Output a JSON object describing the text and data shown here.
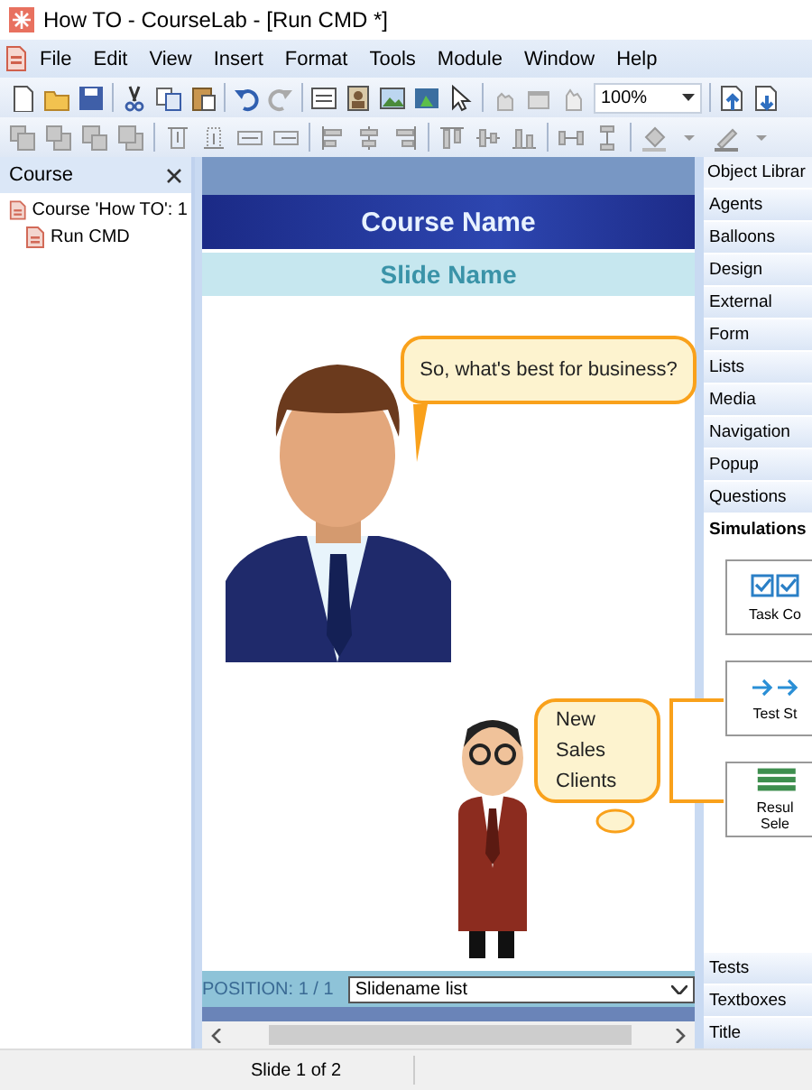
{
  "window": {
    "title": "How TO - CourseLab - [Run CMD *]"
  },
  "menu": [
    {
      "label": "File"
    },
    {
      "label": "Edit"
    },
    {
      "label": "View"
    },
    {
      "label": "Insert"
    },
    {
      "label": "Format"
    },
    {
      "label": "Tools"
    },
    {
      "label": "Module"
    },
    {
      "label": "Window"
    },
    {
      "label": "Help"
    }
  ],
  "toolbar": {
    "zoom": "100%"
  },
  "course_panel": {
    "title": "Course",
    "tree": [
      {
        "label": "Course 'How TO': 1",
        "children": [
          {
            "label": "Run CMD"
          }
        ]
      }
    ]
  },
  "slide": {
    "course_name": "Course Name",
    "slide_name": "Slide Name",
    "bubbles": [
      "So, what's best for business?",
      "New Sales Clients"
    ],
    "position": "POSITION: 1 / 1",
    "slidename_list": "Slidename list"
  },
  "library": {
    "title": "Object Librar",
    "sections": [
      {
        "label": "Agents",
        "selected": false
      },
      {
        "label": "Balloons",
        "selected": false
      },
      {
        "label": "Design",
        "selected": false
      },
      {
        "label": "External",
        "selected": false
      },
      {
        "label": "Form",
        "selected": false
      },
      {
        "label": "Lists",
        "selected": false
      },
      {
        "label": "Media",
        "selected": false
      },
      {
        "label": "Navigation",
        "selected": false
      },
      {
        "label": "Popup",
        "selected": false
      },
      {
        "label": "Questions",
        "selected": false
      },
      {
        "label": "Simulations",
        "selected": true
      },
      {
        "label": "Tests",
        "selected": false
      },
      {
        "label": "Textboxes",
        "selected": false
      },
      {
        "label": "Title",
        "selected": false
      }
    ],
    "items": [
      {
        "label": "Task Co",
        "kind": "checkboxes"
      },
      {
        "label": "Test St",
        "kind": "arrows"
      },
      {
        "label": "Resul Sele",
        "kind": "bars"
      }
    ]
  },
  "status_bar": {
    "text": "Slide 1 of 2"
  }
}
